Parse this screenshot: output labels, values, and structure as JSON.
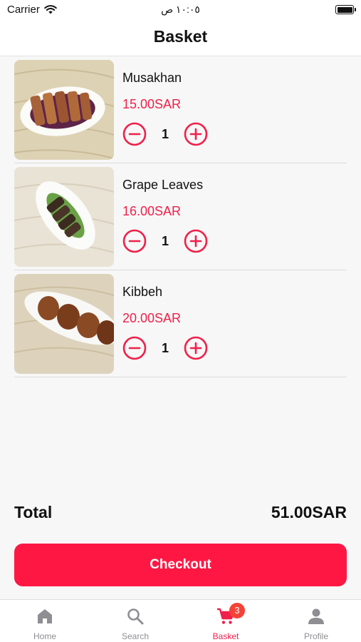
{
  "status_bar": {
    "carrier": "Carrier",
    "time": "١٠:٠٥ ص"
  },
  "header": {
    "title": "Basket"
  },
  "items": [
    {
      "name": "Musakhan",
      "price": "15.00SAR",
      "quantity": "1"
    },
    {
      "name": "Grape Leaves",
      "price": "16.00SAR",
      "quantity": "1"
    },
    {
      "name": "Kibbeh",
      "price": "20.00SAR",
      "quantity": "1"
    }
  ],
  "summary": {
    "total_label": "Total",
    "total_value": "51.00SAR"
  },
  "checkout": {
    "label": "Checkout"
  },
  "tab_bar": {
    "tabs": [
      {
        "label": "Home",
        "icon": "home-icon"
      },
      {
        "label": "Search",
        "icon": "search-icon"
      },
      {
        "label": "Basket",
        "icon": "cart-icon",
        "badge": "3",
        "active": true
      },
      {
        "label": "Profile",
        "icon": "person-icon"
      }
    ]
  },
  "colors": {
    "accent": "#f0204a",
    "button": "#ff1744",
    "badge": "#f44336",
    "inactive_tab": "#8e8e93"
  }
}
